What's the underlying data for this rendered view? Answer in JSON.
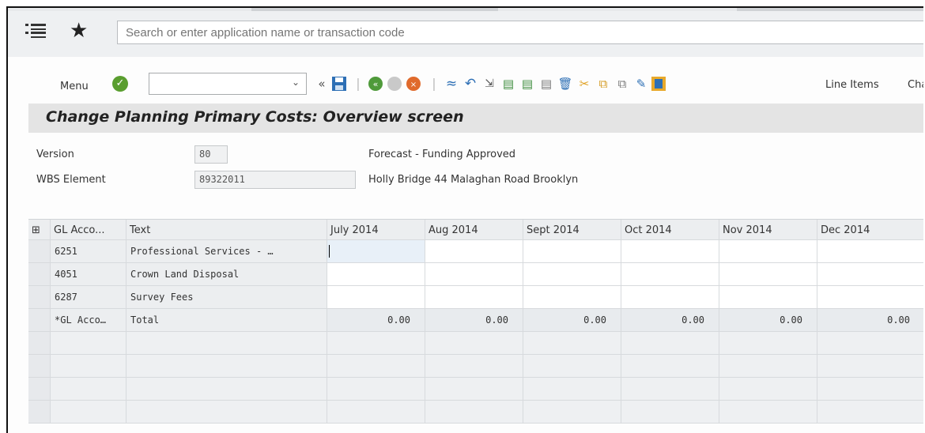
{
  "shell": {
    "search_placeholder": "Search or enter application name or transaction code"
  },
  "toolbar": {
    "menu_label": "Menu",
    "command_value": "",
    "line_items_label": "Line Items",
    "overflow_label": "Cha"
  },
  "page": {
    "title": "Change Planning Primary Costs: Overview screen"
  },
  "header_fields": {
    "version_label": "Version",
    "version_value": "80",
    "version_text": "Forecast - Funding Approved",
    "wbs_label": "WBS Element",
    "wbs_value": "89322011",
    "wbs_text": "Holly Bridge 44 Malaghan Road Brooklyn"
  },
  "table": {
    "columns": [
      "GL Acco...",
      "Text",
      "July 2014",
      "Aug 2014",
      "Sept 2014",
      "Oct 2014",
      "Nov 2014",
      "Dec 2014"
    ],
    "rows": [
      {
        "gl": "6251",
        "text": "Professional Services - …"
      },
      {
        "gl": "4051",
        "text": "Crown Land Disposal"
      },
      {
        "gl": "6287",
        "text": "Survey Fees"
      }
    ],
    "total_row": {
      "gl": "*GL Acco…",
      "text": "Total",
      "values": [
        "0.00",
        "0.00",
        "0.00",
        "0.00",
        "0.00",
        "0.00"
      ]
    }
  },
  "colors": {
    "accent_green": "#5a9e2f",
    "save_blue": "#2d6fb5",
    "title_bg": "#e4e4e4"
  },
  "icons": [
    "hamburger-icon",
    "star-icon",
    "check-icon",
    "chevron-down-icon",
    "double-left-icon",
    "save-icon",
    "back-icon",
    "exit-icon",
    "cancel-icon",
    "revaluation-icon",
    "undo-icon",
    "select-icon",
    "first-page-icon",
    "prev-page-icon",
    "next-page-icon",
    "delete-icon",
    "cut-icon",
    "copy-icon",
    "paste-icon",
    "edit-icon",
    "line-items-icon",
    "column-settings-icon"
  ]
}
